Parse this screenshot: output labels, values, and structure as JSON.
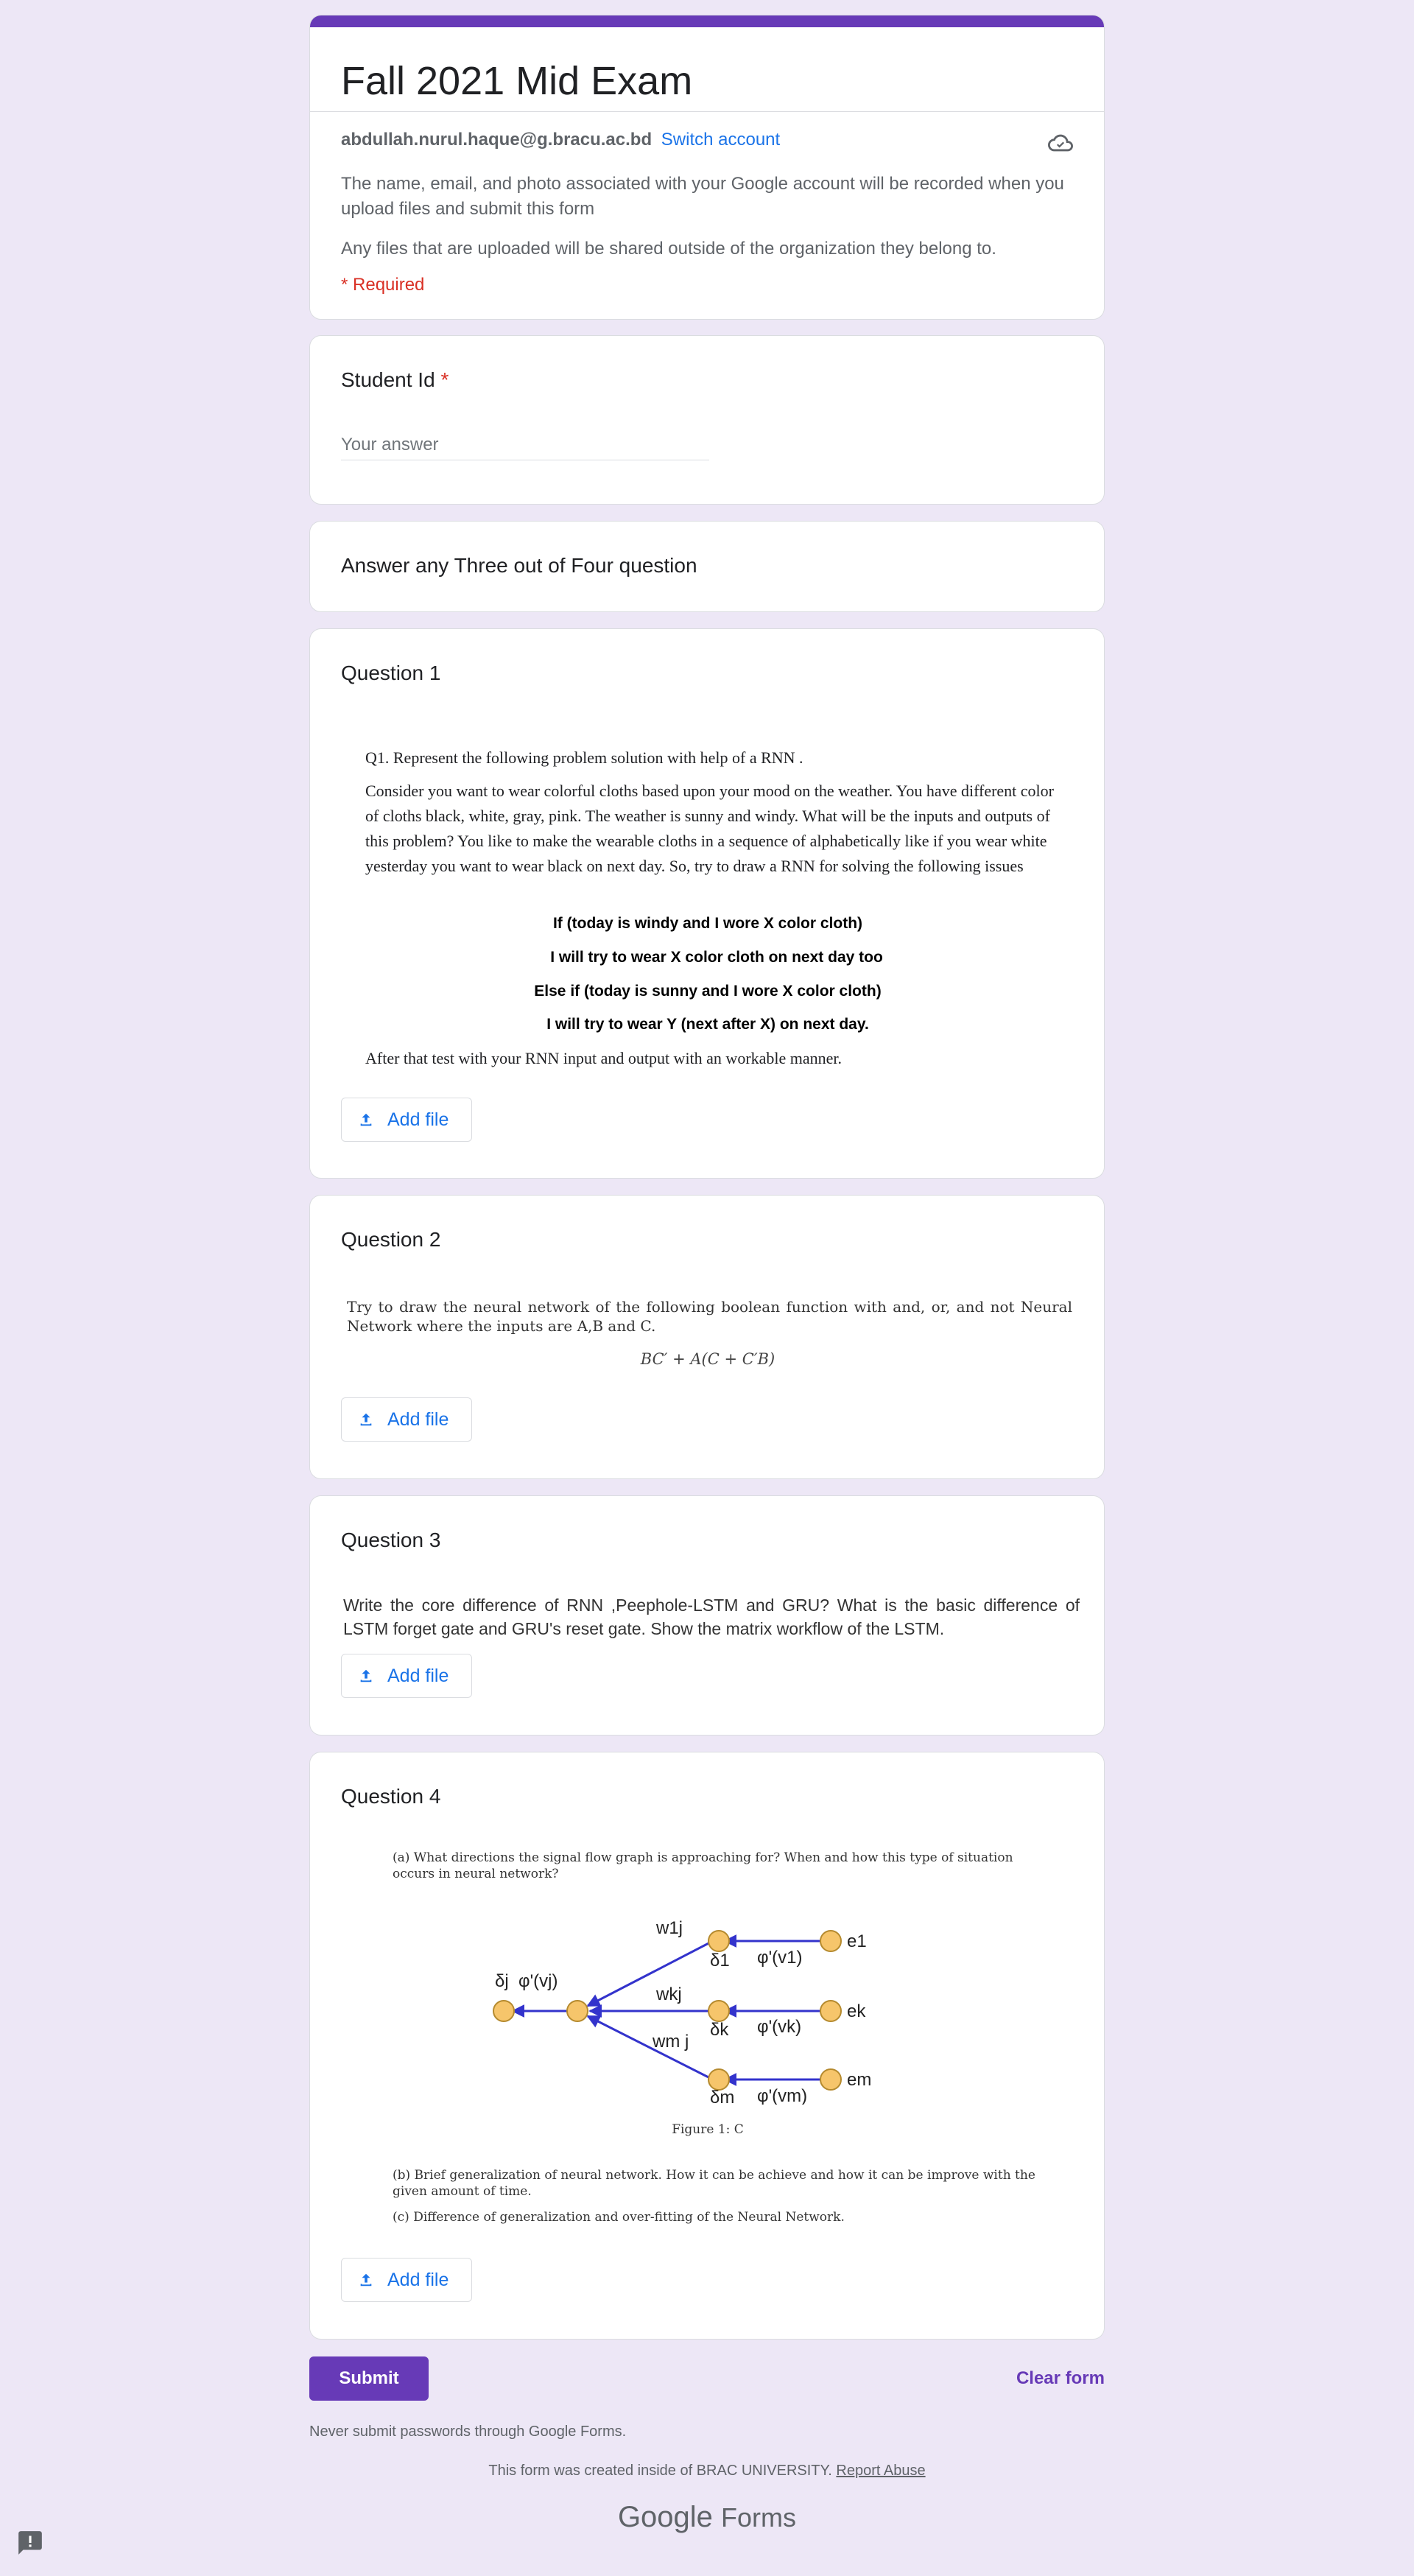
{
  "header": {
    "form_title": "Fall 2021 Mid Exam",
    "account_email": "abdullah.nurul.haque@g.bracu.ac.bd",
    "switch_account": "Switch account",
    "notice_1": "The name, email, and photo associated with your Google account will be recorded when you upload files and submit this form",
    "notice_2": "Any files that are uploaded will be shared outside of the organization they belong to.",
    "required_note": "* Required",
    "cloud_icon": "cloud-sync-icon"
  },
  "student_id": {
    "title": "Student Id",
    "required": "*",
    "placeholder": "Your answer"
  },
  "instructions": {
    "text": "Answer any Three out of Four question"
  },
  "question1": {
    "title": "Question 1",
    "lead": "Q1. Represent the following problem solution with help of a RNN .",
    "body": "Consider you want to wear colorful cloths based upon your mood on the weather. You have different color of cloths black, white, gray, pink. The weather is sunny and windy.  What will be the inputs and outputs of this problem? You like to make the wearable cloths in a sequence of alphabetically like if you wear white yesterday you want to wear black on next day. So, try to draw a RNN for solving the following issues",
    "rule_1": "If (today is windy and I wore X color cloth)",
    "rule_2": "I will try to wear X color cloth on next day too",
    "rule_3": "Else if (today is sunny and I wore X color cloth)",
    "rule_4": "I will try to wear Y (next after X) on next day.",
    "closing": "After that test with your RNN input and output with an workable manner.",
    "add_file": "Add file"
  },
  "question2": {
    "title": "Question 2",
    "body": "Try to draw the neural network of the following boolean function with and, or, and not Neural Network where the inputs are A,B and C.",
    "formula": "BC′ + A(C + C′B)",
    "add_file": "Add file"
  },
  "question3": {
    "title": "Question 3",
    "body": "Write the core difference of RNN ,Peephole-LSTM and GRU? What is the basic difference of LSTM forget gate and GRU's reset gate. Show the matrix workflow of the LSTM.",
    "add_file": "Add file"
  },
  "question4": {
    "title": "Question 4",
    "part_a": "(a)  What directions the signal flow graph is approaching for?  When and how this type of situation occurs in neural network?",
    "figure_labels": {
      "w1j": "w1j",
      "wkj": "wkj",
      "wmj": "wm j",
      "delta_j": "δj",
      "phi_vj": "φ'(vj)",
      "delta_1": "δ1",
      "delta_k": "δk",
      "delta_m": "δm",
      "phi_v1": "φ'(v1)",
      "phi_vk": "φ'(vk)",
      "phi_vm": "φ'(vm)",
      "e1": "e1",
      "ek": "ek",
      "em": "em"
    },
    "caption": "Figure 1: C",
    "part_b": "(b)  Brief generalization of neural network. How it can be achieve and how it can be improve with the given amount of time.",
    "part_c": "(c)  Difference of generalization and over-fitting of the Neural Network.",
    "add_file": "Add file"
  },
  "actions": {
    "submit": "Submit",
    "clear": "Clear form"
  },
  "footer": {
    "never_submit": "Never submit passwords through Google Forms.",
    "created_prefix": "This form was created inside of BRAC UNIVERSITY.",
    "report_abuse": "Report Abuse",
    "logo_google": "Google",
    "logo_forms": "Forms"
  },
  "colors": {
    "theme": "#673ab7",
    "background": "#ede7f6",
    "link": "#1a73e8",
    "required": "#d93025",
    "node_fill": "#f6c56b",
    "edge": "#3333cc"
  }
}
